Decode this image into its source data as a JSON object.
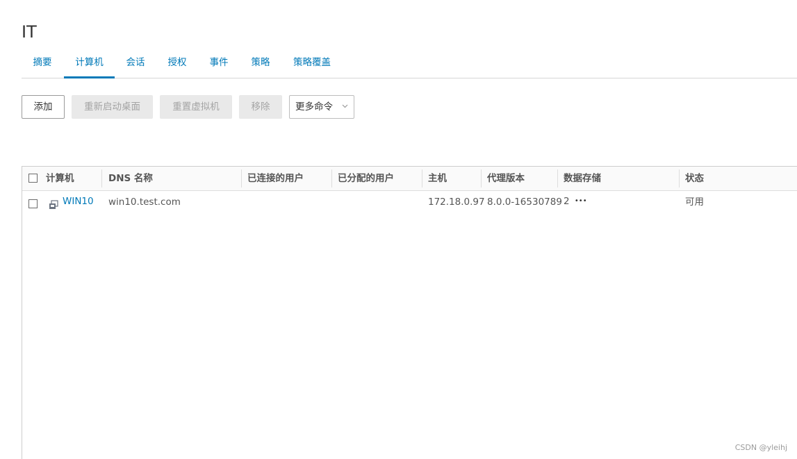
{
  "page": {
    "title": "IT"
  },
  "tabs": [
    {
      "label": "摘要",
      "active": false
    },
    {
      "label": "计算机",
      "active": true
    },
    {
      "label": "会话",
      "active": false
    },
    {
      "label": "授权",
      "active": false
    },
    {
      "label": "事件",
      "active": false
    },
    {
      "label": "策略",
      "active": false
    },
    {
      "label": "策略覆盖",
      "active": false
    }
  ],
  "toolbar": {
    "add_label": "添加",
    "restart_label": "重新启动桌面",
    "reset_label": "重置虚拟机",
    "remove_label": "移除",
    "more_label": "更多命令",
    "more_icon": "chevron-down-icon"
  },
  "grid": {
    "columns": [
      "计算机",
      "DNS 名称",
      "已连接的用户",
      "已分配的用户",
      "主机",
      "代理版本",
      "数据存储",
      "状态"
    ],
    "rows": [
      {
        "computer": "WIN10",
        "computer_icon": "vm-icon",
        "dns_name": "win10.test.com",
        "connected_user": "",
        "assigned_user": "",
        "host": "172.18.0.97",
        "agent_version": "8.0.0-16530789",
        "datastore": "2",
        "datastore_more": "•••",
        "status": "可用"
      }
    ]
  },
  "watermark": "CSDN @yleihj",
  "colors": {
    "accent": "#0079b8",
    "disabled_bg": "#e9e9e9",
    "disabled_text": "#a4a4a4"
  }
}
